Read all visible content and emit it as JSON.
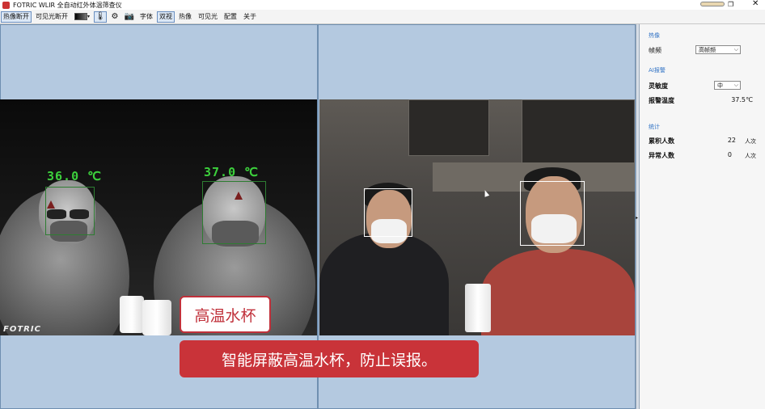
{
  "window": {
    "title": "FOTRIC WLIR 全自动红外体温筛查仪",
    "restore_icon": "restore-icon",
    "close_icon": "close-icon",
    "close_glyph": "✕",
    "restore_glyph": "❐"
  },
  "toolbar": {
    "thermal_toggle": "热像断开",
    "visible_toggle": "可见光断开",
    "font": "字体",
    "dual_view": "双视",
    "thermal_view": "热像",
    "visible_view": "可见光",
    "config": "配置",
    "about": "关于",
    "thermometer_glyph": "🌡",
    "settings_glyph": "⚙",
    "camera_glyph": "📷"
  },
  "thermal": {
    "brand": "FOTRIC",
    "detections": [
      {
        "temp": "36.0 ℃"
      },
      {
        "temp": "37.0 ℃"
      }
    ]
  },
  "captions": {
    "small": "高温水杯",
    "big": "智能屏蔽高温水杯，防止误报。"
  },
  "panel": {
    "thermal_section": "热像",
    "frame_rate_label": "帧频",
    "frame_rate_value": "高帧频",
    "ai_section": "AI报警",
    "sensitivity_label": "灵敏度",
    "sensitivity_value": "中",
    "alarm_temp_label": "报警温度",
    "alarm_temp_value": "37.5℃",
    "stats_section": "统计",
    "total_label": "累积人数",
    "total_value": "22",
    "total_unit": "人次",
    "abnormal_label": "异常人数",
    "abnormal_value": "0",
    "abnormal_unit": "人次"
  }
}
